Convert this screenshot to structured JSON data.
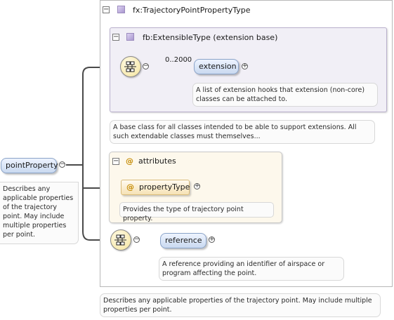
{
  "root": {
    "name": "pointProperty",
    "doc": "Describes any applicable properties of the trajectory point. May include multiple properties per point."
  },
  "complex_type": {
    "name": "fx:TrajectoryPointPropertyType",
    "doc": "Describes any applicable properties of the trajectory point. May include multiple properties per point."
  },
  "extension_base": {
    "name": "fb:ExtensibleType (extension base)",
    "doc": "A base class for all classes intended to be able to support extensions. All such extendable classes must themselves...",
    "occurrence": "0..2000",
    "element": {
      "name": "extension",
      "doc": "A list of extension hooks that extension (non-core) classes can be attached to."
    }
  },
  "attributes": {
    "label": "attributes",
    "symbol": "@",
    "items": [
      {
        "name": "propertyType",
        "doc": "Provides the type of trajectory point property."
      }
    ]
  },
  "reference": {
    "name": "reference",
    "doc": "A reference providing an identifier of airspace or program affecting the point."
  },
  "icons": {
    "collapse": "minus-icon",
    "expand": "plus-icon",
    "sequence": "sequence-icon",
    "complex_type": "complex-type-icon"
  }
}
